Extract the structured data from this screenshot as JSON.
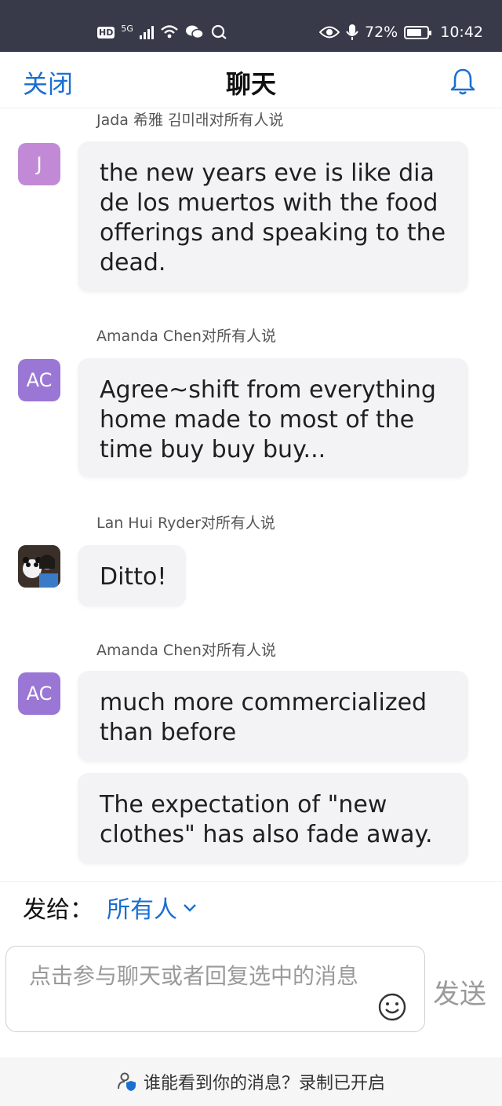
{
  "status_bar": {
    "left": {
      "hd": "HD",
      "network": "5G"
    },
    "right": {
      "battery": "72%",
      "time": "10:42"
    }
  },
  "header": {
    "close_label": "关闭",
    "title": "聊天"
  },
  "messages": [
    {
      "sender": "Jada 希雅 김미래对所有人说",
      "avatar_text": "J",
      "texts": [
        "the new years eve is like dia de los muertos with the food offerings and speaking to the dead."
      ]
    },
    {
      "sender": "Amanda Chen对所有人说",
      "avatar_text": "AC",
      "texts": [
        "Agree~shift from everything home made to most of the time buy buy buy..."
      ]
    },
    {
      "sender": "Lan Hui Ryder对所有人说",
      "avatar_text": "",
      "texts": [
        "Ditto!"
      ]
    },
    {
      "sender": "Amanda Chen对所有人说",
      "avatar_text": "AC",
      "texts": [
        "much more commercialized than before",
        "The expectation of \"new clothes\" has also fade away."
      ]
    }
  ],
  "send_to": {
    "label": "发给：",
    "target": "所有人"
  },
  "input": {
    "placeholder": "点击参与聊天或者回复选中的消息"
  },
  "send_label": "发送",
  "footer": {
    "text": "谁能看到你的消息？录制已开启"
  },
  "colors": {
    "accent": "#1a6fd1",
    "status_bar": "#383a4a",
    "bubble": "#f3f3f6",
    "avatar_j": "#c28ad6",
    "avatar_ac": "#9a77d4"
  }
}
